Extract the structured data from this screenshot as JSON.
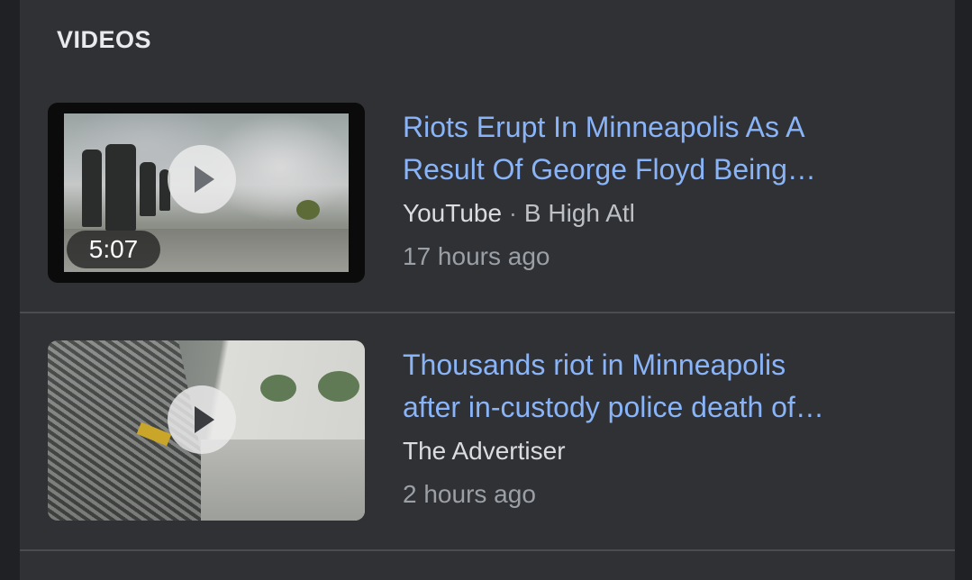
{
  "section": {
    "title": "VIDEOS"
  },
  "videos": [
    {
      "title_line1": "Riots Erupt In Minneapolis As A",
      "title_line2": "Result Of George Floyd Being…",
      "source": "YouTube",
      "separator": " · ",
      "channel": "B High Atl",
      "time": "17 hours ago",
      "duration": "5:07"
    },
    {
      "title_line1": "Thousands riot in Minneapolis",
      "title_line2": "after in-custody police death of…",
      "source": "The Advertiser",
      "time": "2 hours ago"
    }
  ],
  "colors": {
    "background": "#202124",
    "card": "#303134",
    "link": "#8ab4f8",
    "text_secondary": "#9aa0a6"
  },
  "icons": {
    "play": "play-icon"
  }
}
